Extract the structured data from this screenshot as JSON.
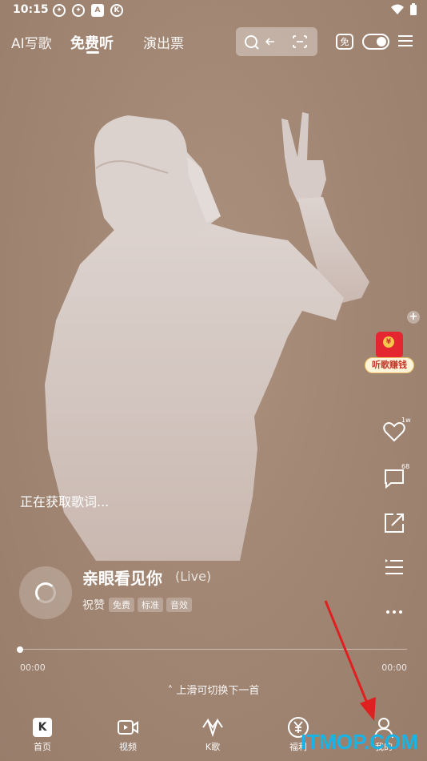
{
  "status_bar": {
    "time": "10:15",
    "icons": [
      "app-icon",
      "app-icon",
      "a-icon",
      "k-icon"
    ],
    "right_icons": [
      "wifi-icon",
      "battery-icon"
    ]
  },
  "top_nav": {
    "tabs": [
      {
        "label": "AI写歌",
        "active": false
      },
      {
        "label": "免费听",
        "active": true
      },
      {
        "label": "演出票",
        "active": false
      }
    ],
    "free_badge": "免"
  },
  "promo": {
    "label": "听歌赚钱"
  },
  "actions": {
    "like_count": "1w",
    "comment_count": "68"
  },
  "lyrics_status": "正在获取歌词...",
  "song": {
    "title": "亲眼看见你",
    "version": "(Live)",
    "artist": "祝赞",
    "tags": [
      "免费",
      "标准",
      "音效"
    ]
  },
  "player": {
    "progress": 0,
    "current_time": "00:00",
    "total_time": "00:00",
    "swipe_hint": "上滑可切换下一首"
  },
  "bottom_nav": [
    {
      "label": "首页",
      "icon": "k-logo-icon"
    },
    {
      "label": "视频",
      "icon": "video-icon"
    },
    {
      "label": "K歌",
      "icon": "k-song-icon"
    },
    {
      "label": "福利",
      "icon": "yuan-icon"
    },
    {
      "label": "我的",
      "icon": "user-icon"
    }
  ],
  "watermark": "ITMOP.COM",
  "colors": {
    "background": "#a58a78",
    "annotation_arrow": "#e02020",
    "watermark": "#1ab3e6",
    "promo_red": "#e3262f"
  }
}
